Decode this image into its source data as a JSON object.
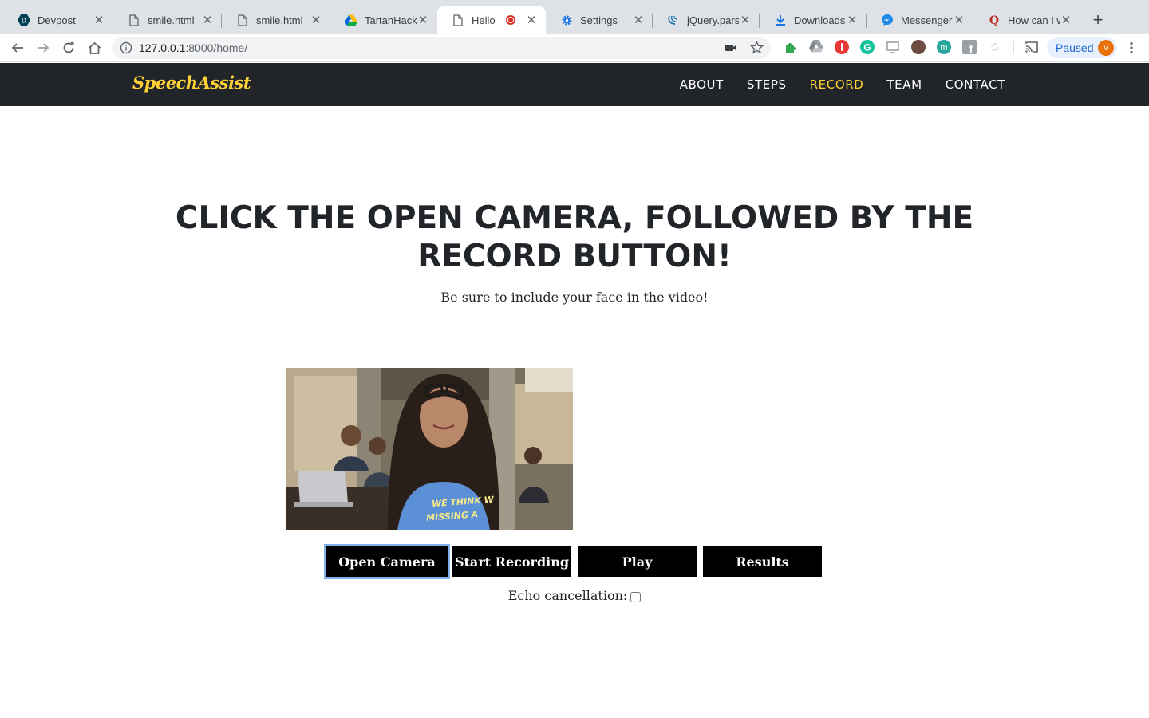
{
  "browser": {
    "tabs": [
      {
        "title": "Devpost",
        "icon": "devpost-icon",
        "active": false
      },
      {
        "title": "smile.html",
        "icon": "file-icon",
        "active": false
      },
      {
        "title": "smile.html",
        "icon": "file-icon",
        "active": false
      },
      {
        "title": "TartanHacks",
        "icon": "google-drive-icon",
        "active": false
      },
      {
        "title": "Hello",
        "icon": "file-icon",
        "active": true,
        "recording": true
      },
      {
        "title": "Settings",
        "icon": "gear-icon",
        "active": false
      },
      {
        "title": "jQuery.parse",
        "icon": "jquery-icon",
        "active": false
      },
      {
        "title": "Downloads",
        "icon": "download-icon",
        "active": false
      },
      {
        "title": "Messenger",
        "icon": "messenger-icon",
        "active": false
      },
      {
        "title": "How can I w",
        "icon": "quora-icon",
        "active": false
      }
    ],
    "address": {
      "host": "127.0.0.1",
      "rest": ":8000/home/"
    },
    "profile_status": "Paused",
    "profile_initial": "V"
  },
  "site": {
    "brand": "SpeechAssist",
    "nav": [
      "ABOUT",
      "STEPS",
      "RECORD",
      "TEAM",
      "CONTACT"
    ],
    "active_nav": "RECORD"
  },
  "main": {
    "heading": "CLICK THE OPEN CAMERA, FOLLOWED BY THE RECORD BUTTON!",
    "subheading": "Be sure to include your face in the video!",
    "buttons": {
      "open_camera": "Open Camera",
      "start_recording": "Start Recording",
      "play": "Play",
      "results": "Results"
    },
    "echo_label": "Echo cancellation:",
    "echo_checked": false
  },
  "colors": {
    "navbar_bg": "#212529",
    "accent": "#fed136",
    "button_bg": "#000000"
  }
}
